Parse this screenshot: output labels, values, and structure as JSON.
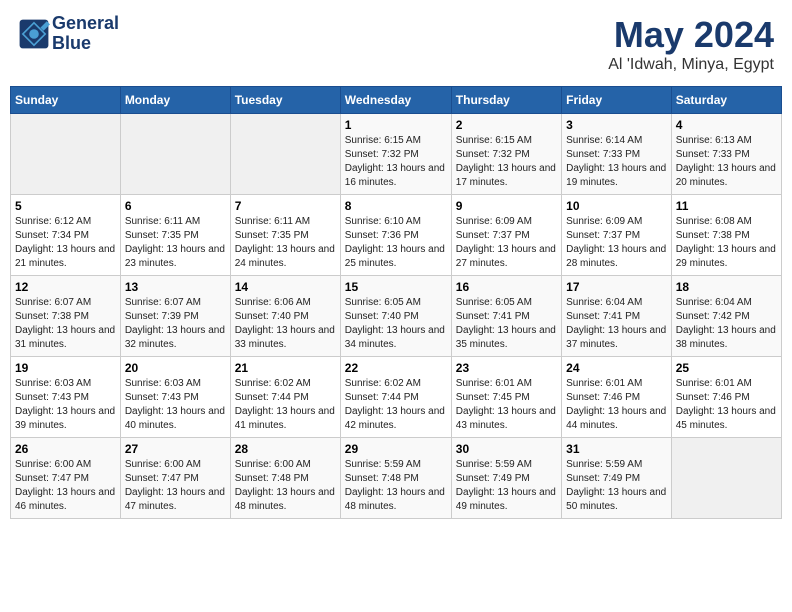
{
  "header": {
    "logo_line1": "General",
    "logo_line2": "Blue",
    "month": "May 2024",
    "location": "Al 'Idwah, Minya, Egypt"
  },
  "weekdays": [
    "Sunday",
    "Monday",
    "Tuesday",
    "Wednesday",
    "Thursday",
    "Friday",
    "Saturday"
  ],
  "weeks": [
    [
      {
        "day": "",
        "info": ""
      },
      {
        "day": "",
        "info": ""
      },
      {
        "day": "",
        "info": ""
      },
      {
        "day": "1",
        "info": "Sunrise: 6:15 AM\nSunset: 7:32 PM\nDaylight: 13 hours and 16 minutes."
      },
      {
        "day": "2",
        "info": "Sunrise: 6:15 AM\nSunset: 7:32 PM\nDaylight: 13 hours and 17 minutes."
      },
      {
        "day": "3",
        "info": "Sunrise: 6:14 AM\nSunset: 7:33 PM\nDaylight: 13 hours and 19 minutes."
      },
      {
        "day": "4",
        "info": "Sunrise: 6:13 AM\nSunset: 7:33 PM\nDaylight: 13 hours and 20 minutes."
      }
    ],
    [
      {
        "day": "5",
        "info": "Sunrise: 6:12 AM\nSunset: 7:34 PM\nDaylight: 13 hours and 21 minutes."
      },
      {
        "day": "6",
        "info": "Sunrise: 6:11 AM\nSunset: 7:35 PM\nDaylight: 13 hours and 23 minutes."
      },
      {
        "day": "7",
        "info": "Sunrise: 6:11 AM\nSunset: 7:35 PM\nDaylight: 13 hours and 24 minutes."
      },
      {
        "day": "8",
        "info": "Sunrise: 6:10 AM\nSunset: 7:36 PM\nDaylight: 13 hours and 25 minutes."
      },
      {
        "day": "9",
        "info": "Sunrise: 6:09 AM\nSunset: 7:37 PM\nDaylight: 13 hours and 27 minutes."
      },
      {
        "day": "10",
        "info": "Sunrise: 6:09 AM\nSunset: 7:37 PM\nDaylight: 13 hours and 28 minutes."
      },
      {
        "day": "11",
        "info": "Sunrise: 6:08 AM\nSunset: 7:38 PM\nDaylight: 13 hours and 29 minutes."
      }
    ],
    [
      {
        "day": "12",
        "info": "Sunrise: 6:07 AM\nSunset: 7:38 PM\nDaylight: 13 hours and 31 minutes."
      },
      {
        "day": "13",
        "info": "Sunrise: 6:07 AM\nSunset: 7:39 PM\nDaylight: 13 hours and 32 minutes."
      },
      {
        "day": "14",
        "info": "Sunrise: 6:06 AM\nSunset: 7:40 PM\nDaylight: 13 hours and 33 minutes."
      },
      {
        "day": "15",
        "info": "Sunrise: 6:05 AM\nSunset: 7:40 PM\nDaylight: 13 hours and 34 minutes."
      },
      {
        "day": "16",
        "info": "Sunrise: 6:05 AM\nSunset: 7:41 PM\nDaylight: 13 hours and 35 minutes."
      },
      {
        "day": "17",
        "info": "Sunrise: 6:04 AM\nSunset: 7:41 PM\nDaylight: 13 hours and 37 minutes."
      },
      {
        "day": "18",
        "info": "Sunrise: 6:04 AM\nSunset: 7:42 PM\nDaylight: 13 hours and 38 minutes."
      }
    ],
    [
      {
        "day": "19",
        "info": "Sunrise: 6:03 AM\nSunset: 7:43 PM\nDaylight: 13 hours and 39 minutes."
      },
      {
        "day": "20",
        "info": "Sunrise: 6:03 AM\nSunset: 7:43 PM\nDaylight: 13 hours and 40 minutes."
      },
      {
        "day": "21",
        "info": "Sunrise: 6:02 AM\nSunset: 7:44 PM\nDaylight: 13 hours and 41 minutes."
      },
      {
        "day": "22",
        "info": "Sunrise: 6:02 AM\nSunset: 7:44 PM\nDaylight: 13 hours and 42 minutes."
      },
      {
        "day": "23",
        "info": "Sunrise: 6:01 AM\nSunset: 7:45 PM\nDaylight: 13 hours and 43 minutes."
      },
      {
        "day": "24",
        "info": "Sunrise: 6:01 AM\nSunset: 7:46 PM\nDaylight: 13 hours and 44 minutes."
      },
      {
        "day": "25",
        "info": "Sunrise: 6:01 AM\nSunset: 7:46 PM\nDaylight: 13 hours and 45 minutes."
      }
    ],
    [
      {
        "day": "26",
        "info": "Sunrise: 6:00 AM\nSunset: 7:47 PM\nDaylight: 13 hours and 46 minutes."
      },
      {
        "day": "27",
        "info": "Sunrise: 6:00 AM\nSunset: 7:47 PM\nDaylight: 13 hours and 47 minutes."
      },
      {
        "day": "28",
        "info": "Sunrise: 6:00 AM\nSunset: 7:48 PM\nDaylight: 13 hours and 48 minutes."
      },
      {
        "day": "29",
        "info": "Sunrise: 5:59 AM\nSunset: 7:48 PM\nDaylight: 13 hours and 48 minutes."
      },
      {
        "day": "30",
        "info": "Sunrise: 5:59 AM\nSunset: 7:49 PM\nDaylight: 13 hours and 49 minutes."
      },
      {
        "day": "31",
        "info": "Sunrise: 5:59 AM\nSunset: 7:49 PM\nDaylight: 13 hours and 50 minutes."
      },
      {
        "day": "",
        "info": ""
      }
    ]
  ]
}
